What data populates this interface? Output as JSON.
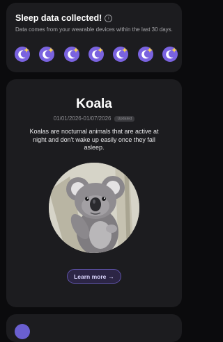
{
  "sleep_card": {
    "title": "Sleep data collected!",
    "subtitle": "Data comes from your wearable devices within the last 30 days.",
    "info_icon": "info-icon",
    "moon_icon": "moon-sparkle-icon",
    "moon_count": 7,
    "moon_color": "#7a63e0",
    "sparkle_color": "#ffd84a"
  },
  "animal_card": {
    "name": "Koala",
    "date_range": "01/01/2026-01/07/2026",
    "badge": "Updated",
    "description": "Koalas are nocturnal animals that are active at night and don't wake up easily once they fall asleep.",
    "learn_more": "Learn more",
    "arrow_icon": "arrow-right-icon"
  },
  "colors": {
    "background": "#0b0b0d",
    "card": "#1c1c1f",
    "accent": "#5e52a8"
  }
}
